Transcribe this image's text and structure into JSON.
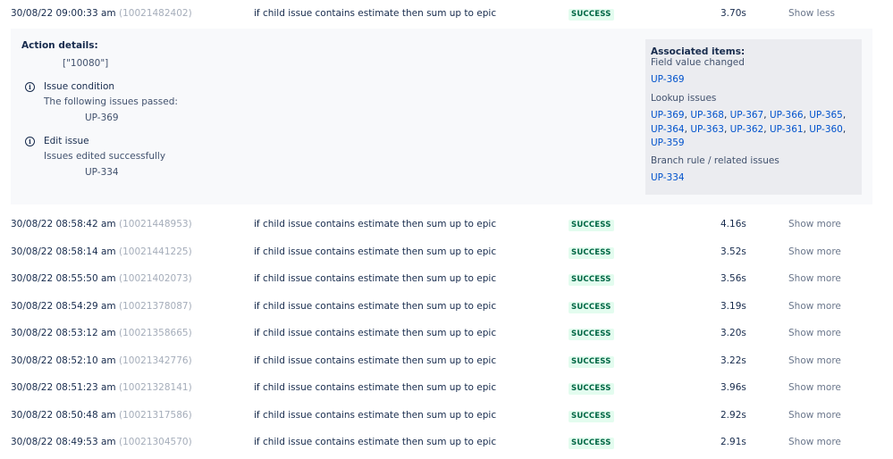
{
  "expanded_row": {
    "date": "30/08/22 09:00:33 am",
    "id": "(10021482402)",
    "rule": "if child issue contains estimate then sum up to epic",
    "status": "SUCCESS",
    "duration": "3.70s",
    "toggle": "Show less"
  },
  "details": {
    "title": "Action details:",
    "payload": "[\"10080\"]",
    "steps": [
      {
        "title": "Issue condition",
        "sub": "The following issues passed:",
        "item": "UP-369"
      },
      {
        "title": "Edit issue",
        "sub": "Issues edited successfully",
        "item": "UP-334"
      }
    ],
    "associated": {
      "heading": "Associated items:",
      "field_changed_label": "Field value changed",
      "field_changed_links": [
        "UP-369"
      ],
      "lookup_label": "Lookup issues",
      "lookup_links": [
        "UP-369",
        "UP-368",
        "UP-367",
        "UP-366",
        "UP-365",
        "UP-364",
        "UP-363",
        "UP-362",
        "UP-361",
        "UP-360",
        "UP-359"
      ],
      "branch_label": "Branch rule / related issues",
      "branch_links": [
        "UP-334"
      ]
    }
  },
  "rows": [
    {
      "date": "30/08/22 08:58:42 am",
      "id": "(10021448953)",
      "rule": "if child issue contains estimate then sum up to epic",
      "status": "SUCCESS",
      "duration": "4.16s",
      "toggle": "Show more"
    },
    {
      "date": "30/08/22 08:58:14 am",
      "id": "(10021441225)",
      "rule": "if child issue contains estimate then sum up to epic",
      "status": "SUCCESS",
      "duration": "3.52s",
      "toggle": "Show more"
    },
    {
      "date": "30/08/22 08:55:50 am",
      "id": "(10021402073)",
      "rule": "if child issue contains estimate then sum up to epic",
      "status": "SUCCESS",
      "duration": "3.56s",
      "toggle": "Show more"
    },
    {
      "date": "30/08/22 08:54:29 am",
      "id": "(10021378087)",
      "rule": "if child issue contains estimate then sum up to epic",
      "status": "SUCCESS",
      "duration": "3.19s",
      "toggle": "Show more"
    },
    {
      "date": "30/08/22 08:53:12 am",
      "id": "(10021358665)",
      "rule": "if child issue contains estimate then sum up to epic",
      "status": "SUCCESS",
      "duration": "3.20s",
      "toggle": "Show more"
    },
    {
      "date": "30/08/22 08:52:10 am",
      "id": "(10021342776)",
      "rule": "if child issue contains estimate then sum up to epic",
      "status": "SUCCESS",
      "duration": "3.22s",
      "toggle": "Show more"
    },
    {
      "date": "30/08/22 08:51:23 am",
      "id": "(10021328141)",
      "rule": "if child issue contains estimate then sum up to epic",
      "status": "SUCCESS",
      "duration": "3.96s",
      "toggle": "Show more"
    },
    {
      "date": "30/08/22 08:50:48 am",
      "id": "(10021317586)",
      "rule": "if child issue contains estimate then sum up to epic",
      "status": "SUCCESS",
      "duration": "2.92s",
      "toggle": "Show more"
    },
    {
      "date": "30/08/22 08:49:53 am",
      "id": "(10021304570)",
      "rule": "if child issue contains estimate then sum up to epic",
      "status": "SUCCESS",
      "duration": "2.91s",
      "toggle": "Show more"
    }
  ],
  "colors": {
    "success_bg": "#e3fcef",
    "success_text": "#006644",
    "link": "#0052cc",
    "muted_id": "#a5adba",
    "toggle": "#6b778c"
  }
}
